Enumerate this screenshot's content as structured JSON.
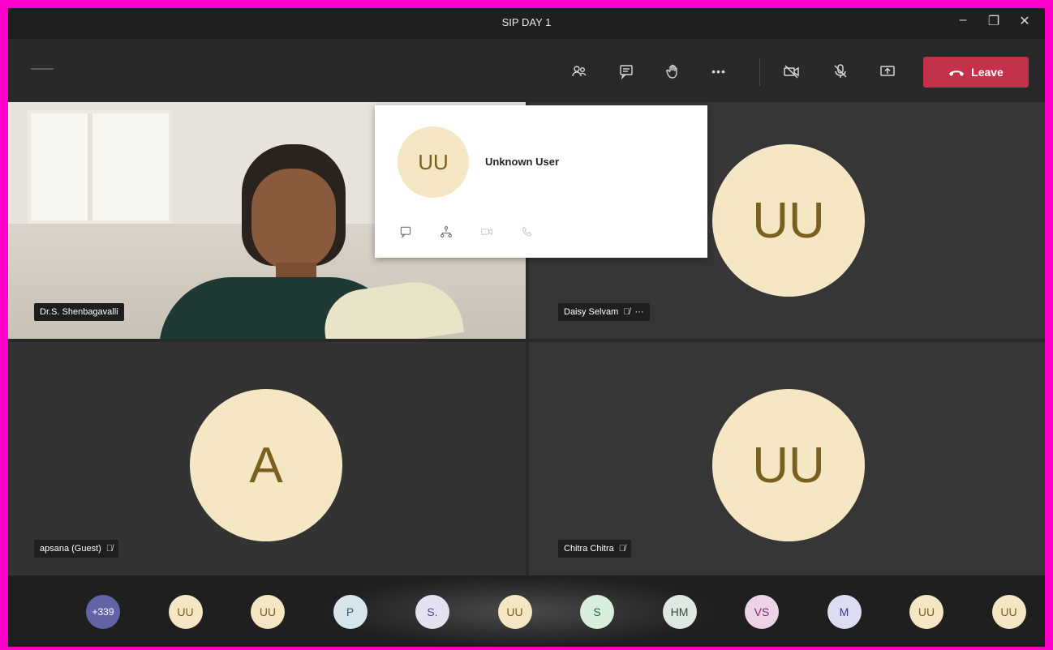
{
  "window": {
    "title": "SIP DAY 1",
    "minimize": "–",
    "restore": "❐",
    "close": "✕"
  },
  "toolbar": {
    "participants_icon": "participants-icon",
    "chat_icon": "chat-icon",
    "raise_hand_icon": "raise-hand-icon",
    "more_label": "•••",
    "camera_icon": "camera-off-icon",
    "mic_icon": "mic-off-icon",
    "share_icon": "share-screen-icon",
    "leave_label": "Leave"
  },
  "tiles": [
    {
      "name": "Dr.S. Shenbagavalli",
      "type": "video"
    },
    {
      "name": "Daisy Selvam",
      "initials": "UU",
      "more": "···"
    },
    {
      "name": "apsana (Guest)",
      "initials": "A"
    },
    {
      "name": "Chitra Chitra",
      "initials": "UU"
    }
  ],
  "popup": {
    "initials": "UU",
    "name": "Unknown User",
    "actions": [
      "chat-icon",
      "org-chart-icon",
      "video-icon",
      "call-icon"
    ]
  },
  "roster": [
    {
      "label": "+339",
      "bg": "#6264a7",
      "fg": "#ffffff"
    },
    {
      "label": "UU",
      "bg": "#f5e6c4",
      "fg": "#7a5f1f"
    },
    {
      "label": "UU",
      "bg": "#f5e6c4",
      "fg": "#7a5f1f"
    },
    {
      "label": "P",
      "bg": "#d6e4ec",
      "fg": "#3a5a6a"
    },
    {
      "label": "S.",
      "bg": "#e4e1f1",
      "fg": "#4a4a8a"
    },
    {
      "label": "UU",
      "bg": "#f5e6c4",
      "fg": "#7a5f1f"
    },
    {
      "label": "S",
      "bg": "#d9eedd",
      "fg": "#2a6a3a"
    },
    {
      "label": "HM",
      "bg": "#dfe8e1",
      "fg": "#3a4a3e"
    },
    {
      "label": "VS",
      "bg": "#ecd3e6",
      "fg": "#8a2a6a"
    },
    {
      "label": "M",
      "bg": "#dcdcf2",
      "fg": "#3a3a7a"
    },
    {
      "label": "UU",
      "bg": "#f5e6c4",
      "fg": "#7a5f1f"
    },
    {
      "label": "UU",
      "bg": "#f5e6c4",
      "fg": "#7a5f1f"
    }
  ]
}
